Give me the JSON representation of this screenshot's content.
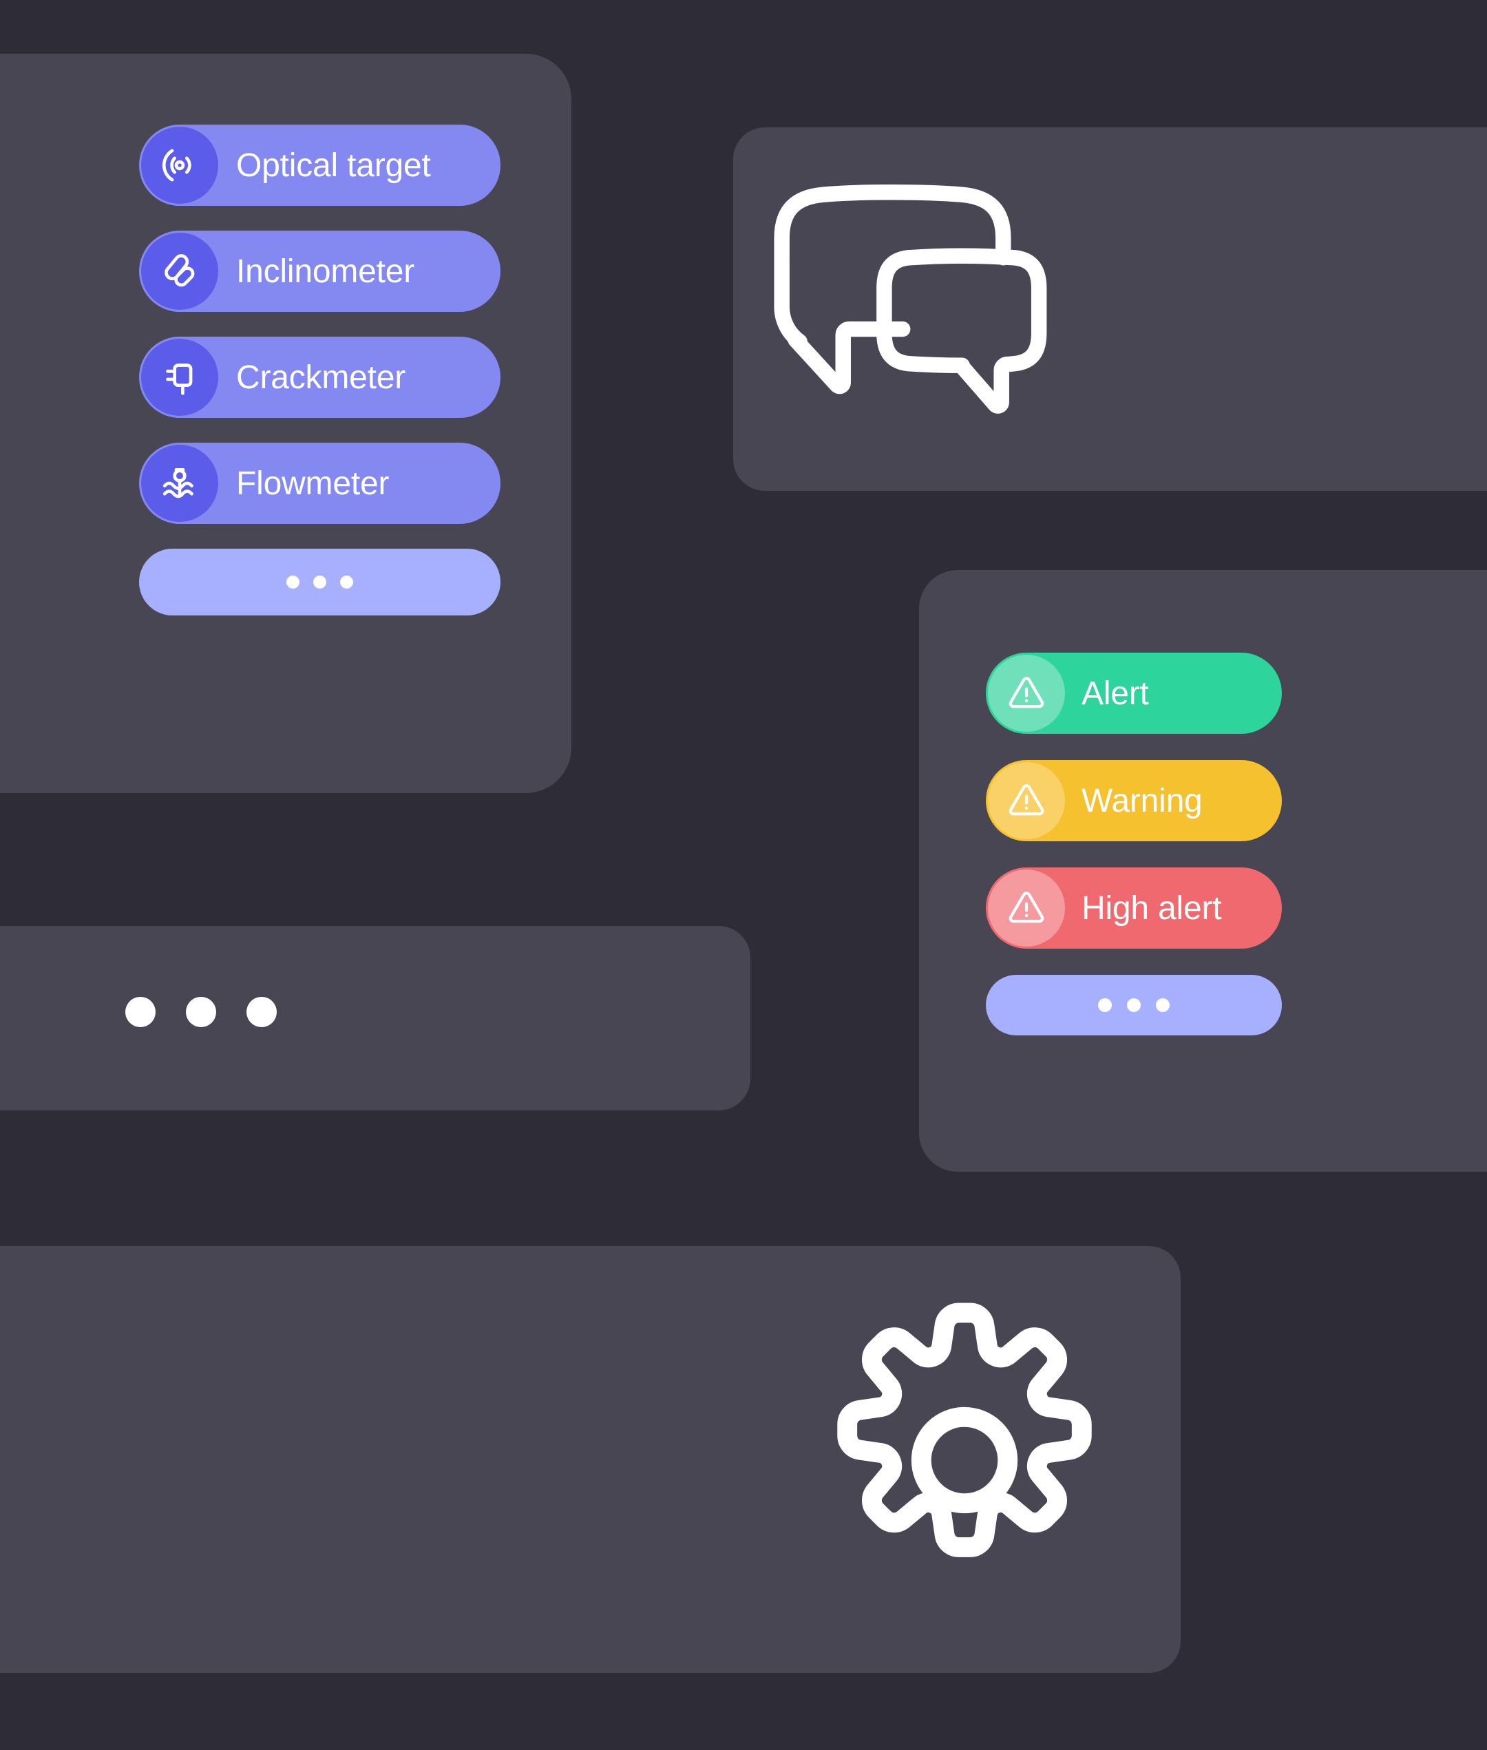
{
  "theme": {
    "page_background": "#2e2c36",
    "card_background": "#474652",
    "sensor_pill": "#8489f1",
    "sensor_icon_circle": "#5b5cea",
    "more_pill": "#a7afff",
    "alert_green": "#2dd49b",
    "alert_green_badge": "#6fe0b9",
    "alert_yellow": "#f5c12f",
    "alert_yellow_badge": "#fad167",
    "alert_red": "#f0696e",
    "alert_red_badge": "#f59ba0",
    "text_on_pill": "#ffffff",
    "icon_stroke": "#ffffff"
  },
  "sensors_card": {
    "items": [
      {
        "label": "Optical target",
        "icon": "optical-target-icon"
      },
      {
        "label": "Inclinometer",
        "icon": "inclinometer-icon"
      },
      {
        "label": "Crackmeter",
        "icon": "crackmeter-icon"
      },
      {
        "label": "Flowmeter",
        "icon": "flowmeter-icon"
      }
    ],
    "more": {
      "icon": "ellipsis-icon",
      "dots": 3
    }
  },
  "chat_card": {
    "icon": "chat-bubbles-icon"
  },
  "alerts_card": {
    "items": [
      {
        "label": "Alert",
        "icon": "warning-triangle-icon",
        "color": "#2dd49b",
        "badge": "#6fe0b9"
      },
      {
        "label": "Warning",
        "icon": "warning-triangle-icon",
        "color": "#f5c12f",
        "badge": "#fad167"
      },
      {
        "label": "High alert",
        "icon": "warning-triangle-icon",
        "color": "#f0696e",
        "badge": "#f59ba0"
      }
    ],
    "more": {
      "icon": "ellipsis-icon",
      "dots": 3
    }
  },
  "dots_card": {
    "icon": "three-dots-icon",
    "dots": 3
  },
  "gear_card": {
    "icon": "gear-icon"
  }
}
